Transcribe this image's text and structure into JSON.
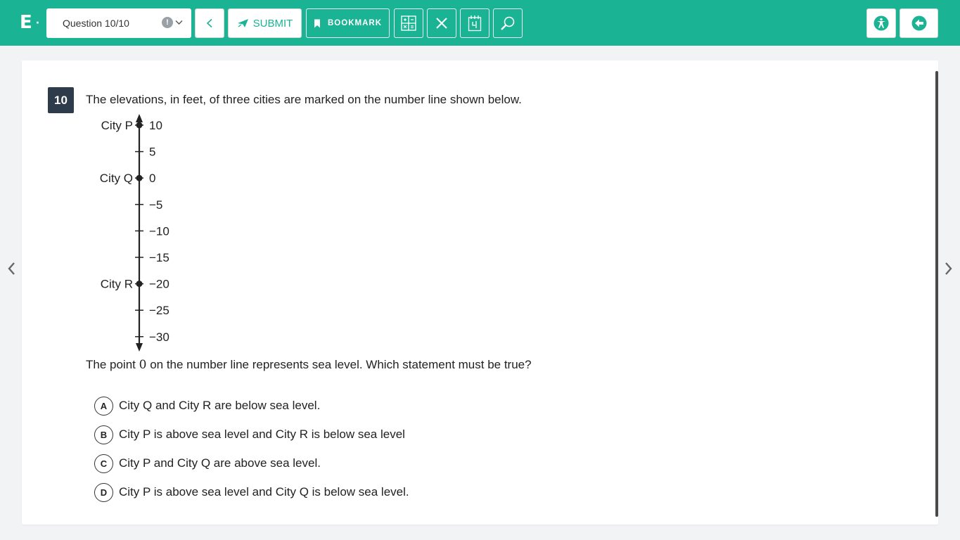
{
  "header": {
    "logo": "E",
    "logo_dot": "·",
    "question_selector": {
      "label": "Question 10/10",
      "flag": "!"
    },
    "submit_label": "SUBMIT",
    "bookmark_label": "BOOKMARK",
    "icons": [
      "back-arrow-icon",
      "submit-icon",
      "bookmark-icon",
      "calculator-icon",
      "close-icon",
      "notepad-icon",
      "magnifier-icon",
      "accessibility-icon",
      "exit-icon"
    ]
  },
  "question": {
    "number": "10",
    "prompt": "The elevations, in feet, of three cities are marked on the number line shown below.",
    "follow_up_before": "The point",
    "follow_up_zero": "0",
    "follow_up_after": "on the number line represents sea level. Which statement must be true?",
    "number_line": {
      "ticks": [
        10,
        5,
        0,
        -5,
        -10,
        -15,
        -20,
        -25,
        -30
      ],
      "tick_labels": [
        "10",
        "5",
        "0",
        "−5",
        "−10",
        "−15",
        "−20",
        "−25",
        "−30"
      ],
      "points": [
        {
          "label": "City P",
          "value": 10
        },
        {
          "label": "City Q",
          "value": 0
        },
        {
          "label": "City R",
          "value": -20
        }
      ]
    },
    "choices": [
      {
        "letter": "A",
        "text": "City Q and City R are below sea level."
      },
      {
        "letter": "B",
        "text": "City P is above sea level and City R is below sea level"
      },
      {
        "letter": "C",
        "text": "City P and City Q are above sea level."
      },
      {
        "letter": "D",
        "text": "City P is above sea level and City Q is below sea level."
      }
    ]
  },
  "colors": {
    "brand": "#1ab394",
    "badge": "#2e3b4a",
    "background": "#f2f3f5"
  }
}
